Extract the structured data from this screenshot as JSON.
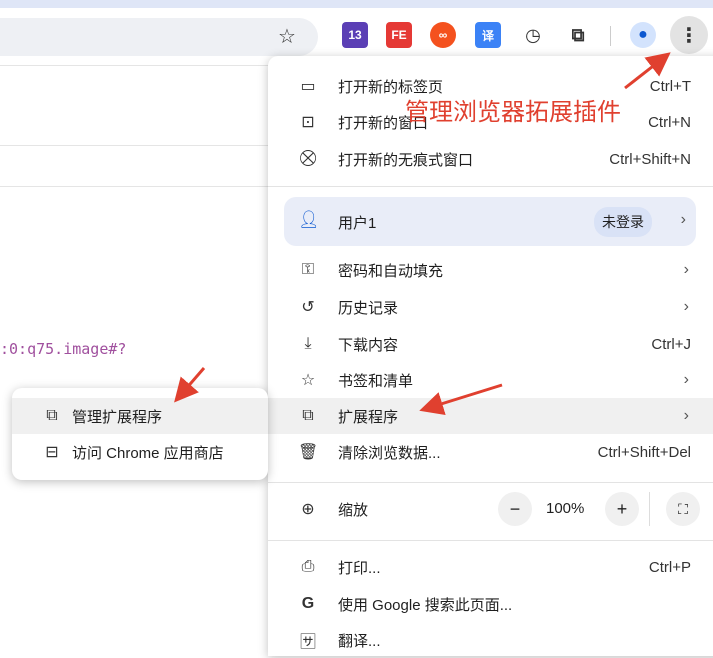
{
  "toolbar": {
    "extensions": [
      {
        "name": "13",
        "color": "#5b3fb5"
      },
      {
        "name": "FE",
        "color": "#e53935"
      },
      {
        "name": "∞",
        "color": "#f4511e"
      },
      {
        "name": "译",
        "color": "#3b82f6"
      }
    ]
  },
  "page": {
    "code_text": ":0:q75.image#?"
  },
  "annotation": {
    "text": "管理浏览器拓展插件",
    "color": "#e0402f"
  },
  "menu": {
    "new_tab": {
      "label": "打开新的标签页",
      "shortcut": "Ctrl+T"
    },
    "new_window": {
      "label": "打开新的窗口",
      "shortcut": "Ctrl+N"
    },
    "incognito": {
      "label": "打开新的无痕式窗口",
      "shortcut": "Ctrl+Shift+N"
    },
    "profile": {
      "label": "用户1",
      "status": "未登录"
    },
    "passwords": {
      "label": "密码和自动填充"
    },
    "history": {
      "label": "历史记录"
    },
    "downloads": {
      "label": "下载内容",
      "shortcut": "Ctrl+J"
    },
    "bookmarks": {
      "label": "书签和清单"
    },
    "extensions": {
      "label": "扩展程序"
    },
    "clear": {
      "label": "清除浏览数据...",
      "shortcut": "Ctrl+Shift+Del"
    },
    "zoom": {
      "label": "缩放",
      "value": "100%",
      "minus": "−",
      "plus": "+"
    },
    "print": {
      "label": "打印...",
      "shortcut": "Ctrl+P"
    },
    "search": {
      "label": "使用 Google 搜索此页面..."
    },
    "translate": {
      "label": "翻译..."
    }
  },
  "submenu": {
    "manage": "管理扩展程序",
    "store": "访问 Chrome 应用商店"
  }
}
